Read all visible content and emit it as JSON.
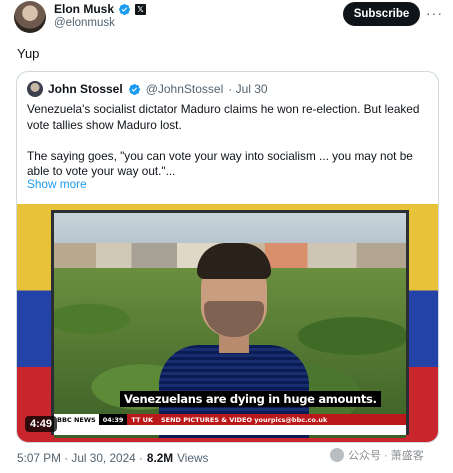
{
  "author": {
    "name": "Elon Musk",
    "handle": "@elonmusk",
    "x_badge": "𝕏",
    "subscribe_label": "Subscribe",
    "more_label": "···"
  },
  "tweet": {
    "text": "Yup",
    "date": "5:07 PM · Jul 30, 2024 ·",
    "views_count": "8.2M",
    "views_label": "Views"
  },
  "quote": {
    "name": "John Stossel",
    "handle": "@JohnStossel",
    "time": "· Jul 30",
    "paragraph1": "Venezuela's socialist dictator Maduro claims he won re-election. But leaked vote tallies show Maduro lost.",
    "paragraph2": "The saying goes, \"you can vote your way into socialism ... you may not be able to vote your way out.\"...",
    "show_more": "Show more"
  },
  "video": {
    "caption": "Venezuelans are dying in huge amounts.",
    "ticker_brand": "BBC NEWS",
    "ticker_time": "04:39",
    "ticker_channel": "TT UK",
    "ticker_text": "SEND PICTURES & VIDEO yourpics@bbc.co.uk",
    "duration": "4:49"
  },
  "watermark": {
    "text": "公众号 · 萧盛客"
  },
  "colors": {
    "accent": "#1d9bf0",
    "verified": "#1d9bf0",
    "bbc_red": "#bb1919"
  }
}
